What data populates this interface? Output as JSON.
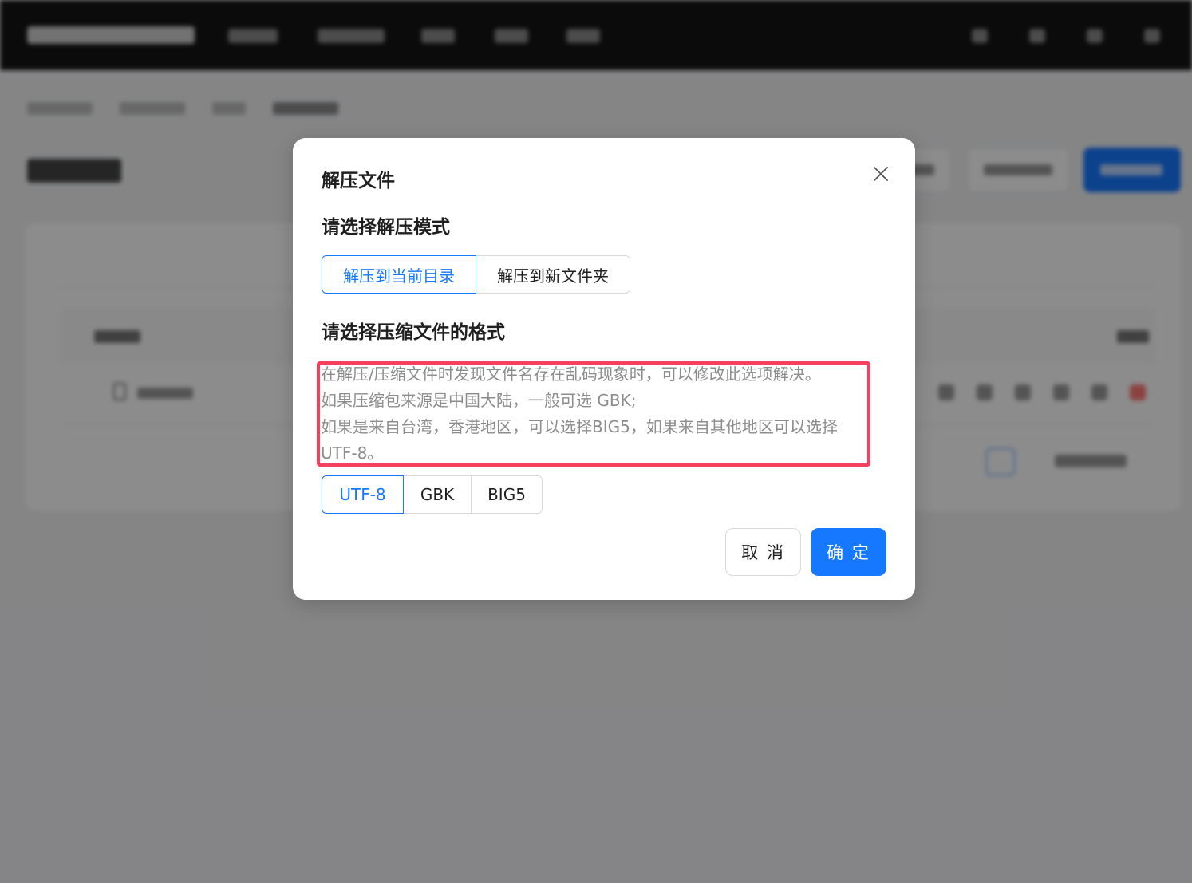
{
  "modal": {
    "title": "解压文件",
    "close_icon": "close-icon",
    "mode_section": {
      "title": "请选择解压模式",
      "options": [
        "解压到当前目录",
        "解压到新文件夹"
      ],
      "selected": "解压到当前目录"
    },
    "format_section": {
      "title": "请选择压缩文件的格式",
      "hint_lines": [
        "在解压/压缩文件时发现文件名存在乱码现象时，可以修改此选项解决。",
        "如果压缩包来源是中国大陆，一般可选 GBK;",
        "如果是来自台湾，香港地区，可以选择BIG5，如果来自其他地区可以选择",
        "UTF-8。"
      ],
      "options": [
        "UTF-8",
        "GBK",
        "BIG5"
      ],
      "selected": "UTF-8"
    },
    "buttons": {
      "cancel": "取 消",
      "ok": "确 定"
    }
  },
  "colors": {
    "primary": "#1677ff",
    "highlight_border": "#f5415c",
    "topbar": "#141414",
    "mask": "rgba(0,0,0,0.45)"
  }
}
